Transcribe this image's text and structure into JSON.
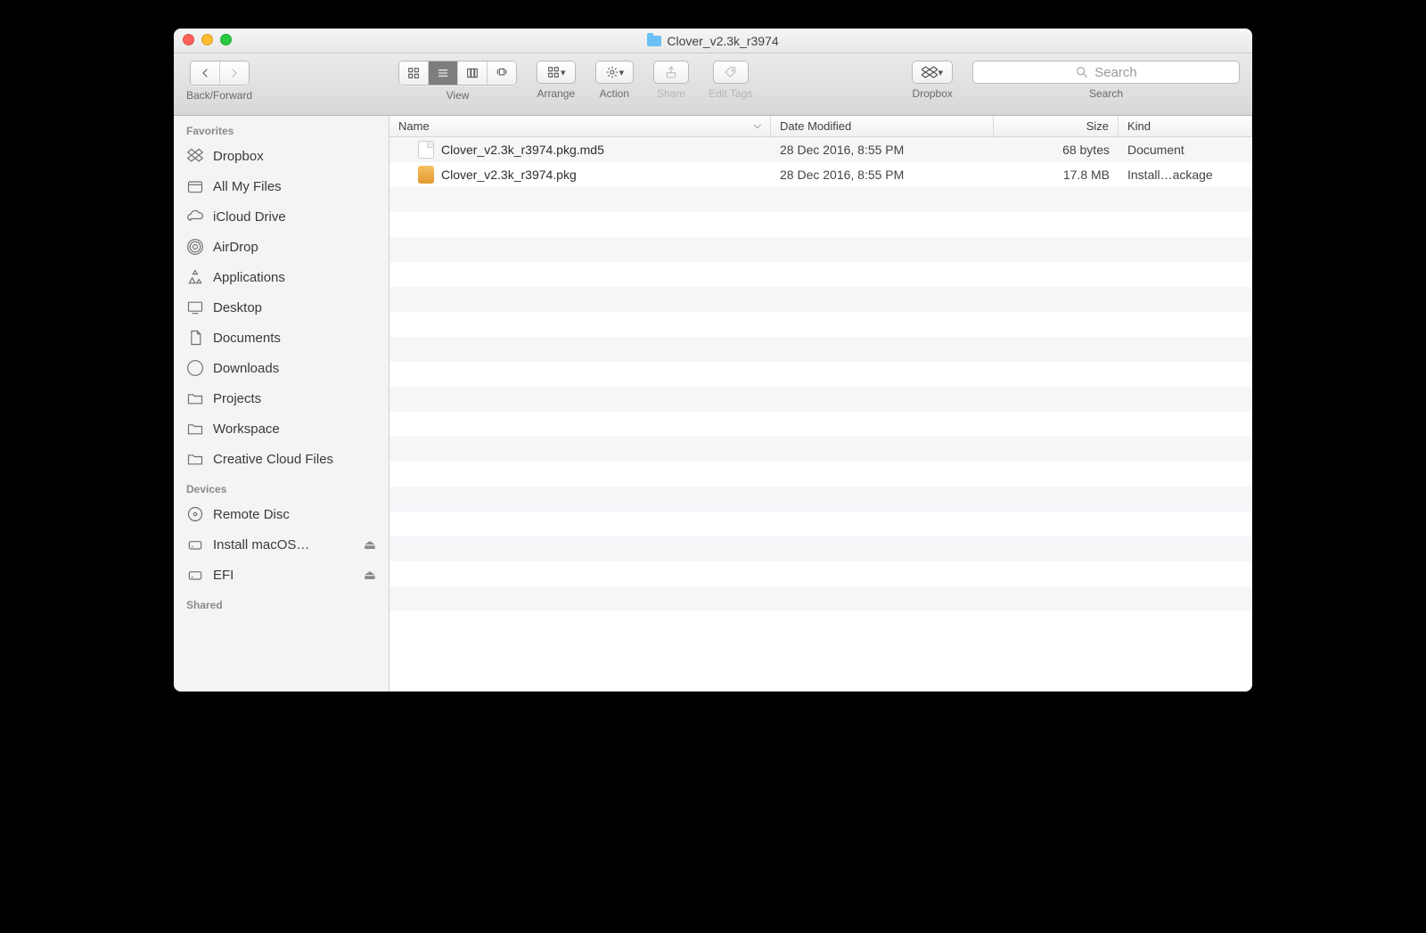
{
  "window": {
    "title": "Clover_v2.3k_r3974"
  },
  "toolbar": {
    "back_forward_label": "Back/Forward",
    "view_label": "View",
    "arrange_label": "Arrange",
    "action_label": "Action",
    "share_label": "Share",
    "tags_label": "Edit Tags",
    "dropbox_label": "Dropbox",
    "search_label": "Search",
    "search_placeholder": "Search"
  },
  "sidebar": {
    "favorites_header": "Favorites",
    "devices_header": "Devices",
    "shared_header": "Shared",
    "favorites": [
      {
        "label": "Dropbox",
        "icon": "dropbox"
      },
      {
        "label": "All My Files",
        "icon": "allfiles"
      },
      {
        "label": "iCloud Drive",
        "icon": "icloud"
      },
      {
        "label": "AirDrop",
        "icon": "airdrop"
      },
      {
        "label": "Applications",
        "icon": "apps"
      },
      {
        "label": "Desktop",
        "icon": "desktop"
      },
      {
        "label": "Documents",
        "icon": "documents"
      },
      {
        "label": "Downloads",
        "icon": "downloads"
      },
      {
        "label": "Projects",
        "icon": "folder"
      },
      {
        "label": "Workspace",
        "icon": "folder"
      },
      {
        "label": "Creative Cloud Files",
        "icon": "folder"
      }
    ],
    "devices": [
      {
        "label": "Remote Disc",
        "icon": "disc",
        "eject": false
      },
      {
        "label": "Install macOS…",
        "icon": "drive",
        "eject": true
      },
      {
        "label": "EFI",
        "icon": "drive",
        "eject": true
      }
    ]
  },
  "columns": {
    "name": "Name",
    "date": "Date Modified",
    "size": "Size",
    "kind": "Kind"
  },
  "files": [
    {
      "name": "Clover_v2.3k_r3974.pkg.md5",
      "date": "28 Dec 2016, 8:55 PM",
      "size": "68 bytes",
      "kind": "Document",
      "icon": "doc"
    },
    {
      "name": "Clover_v2.3k_r3974.pkg",
      "date": "28 Dec 2016, 8:55 PM",
      "size": "17.8 MB",
      "kind": "Install…ackage",
      "icon": "pkg"
    }
  ],
  "empty_rows": 18
}
